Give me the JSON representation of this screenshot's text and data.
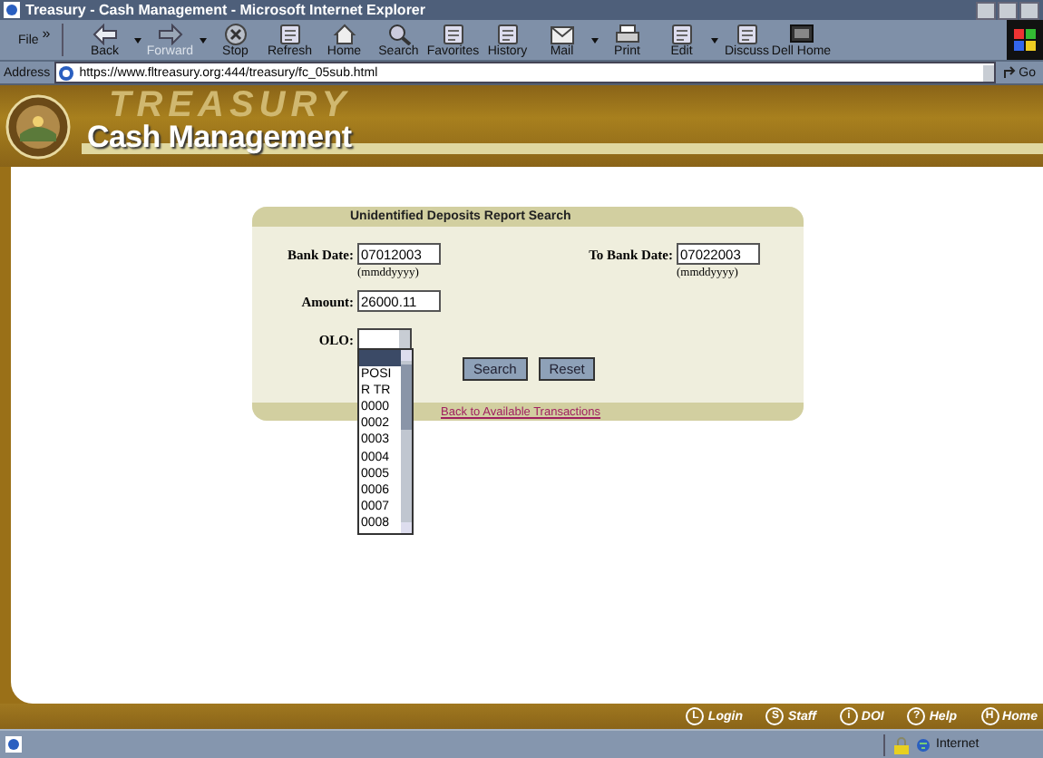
{
  "window": {
    "title": "Treasury - Cash Management - Microsoft Internet Explorer"
  },
  "menu": {
    "label": "File",
    "more": "»"
  },
  "toolbar": [
    {
      "label": "Back",
      "disabled": false,
      "dropdown": true
    },
    {
      "label": "Forward",
      "disabled": true,
      "dropdown": true
    },
    {
      "label": "Stop",
      "disabled": false,
      "dropdown": false
    },
    {
      "label": "Refresh",
      "disabled": false,
      "dropdown": false
    },
    {
      "label": "Home",
      "disabled": false,
      "dropdown": false
    },
    {
      "label": "Search",
      "disabled": false,
      "dropdown": false
    },
    {
      "label": "Favorites",
      "disabled": false,
      "dropdown": false
    },
    {
      "label": "History",
      "disabled": false,
      "dropdown": false
    },
    {
      "label": "Mail",
      "disabled": false,
      "dropdown": true
    },
    {
      "label": "Print",
      "disabled": false,
      "dropdown": false
    },
    {
      "label": "Edit",
      "disabled": false,
      "dropdown": true
    },
    {
      "label": "Discuss",
      "disabled": false,
      "dropdown": false
    },
    {
      "label": "Dell Home",
      "disabled": false,
      "dropdown": false
    }
  ],
  "address": {
    "label": "Address",
    "url": "https://www.fltreasury.org:444/treasury/fc_05sub.html",
    "go": "Go"
  },
  "banner": {
    "background_text": "TREASURY",
    "title": "Cash Management"
  },
  "form": {
    "title": "Unidentified Deposits Report Search",
    "bank_date": {
      "label": "Bank Date:",
      "value": "07012003",
      "hint": "(mmddyyyy)"
    },
    "to_bank_date": {
      "label": "To Bank Date:",
      "value": "07022003",
      "hint": "(mmddyyyy)"
    },
    "amount": {
      "label": "Amount:",
      "value": "26000.11"
    },
    "olo": {
      "label": "OLO:",
      "expanded": true,
      "options": [
        {
          "selected": true
        },
        {
          "label": "POSI",
          "selected": false
        },
        {
          "label": "R TR",
          "selected": false
        },
        {
          "label": "0000",
          "selected": false
        },
        {
          "label": "0002",
          "selected": false
        },
        {
          "label": "0003",
          "selected": false
        },
        {
          "label": "0004",
          "selected": false
        },
        {
          "label": "0005",
          "selected": false
        },
        {
          "label": "0006",
          "selected": false
        },
        {
          "label": "0007",
          "selected": false
        },
        {
          "label": "0008",
          "selected": false
        }
      ]
    },
    "buttons": [
      "Search",
      "Reset"
    ],
    "link": "Back to Available Transactions"
  },
  "footer_links": [
    {
      "icon_letter": "L",
      "label": "Login"
    },
    {
      "icon_letter": "S",
      "label": "Staff"
    },
    {
      "icon_letter": "i",
      "label": "DOI"
    },
    {
      "icon_letter": "?",
      "label": "Help"
    },
    {
      "icon_letter": "H",
      "label": "Home"
    }
  ],
  "status_bar": {
    "zone": "Internet"
  }
}
